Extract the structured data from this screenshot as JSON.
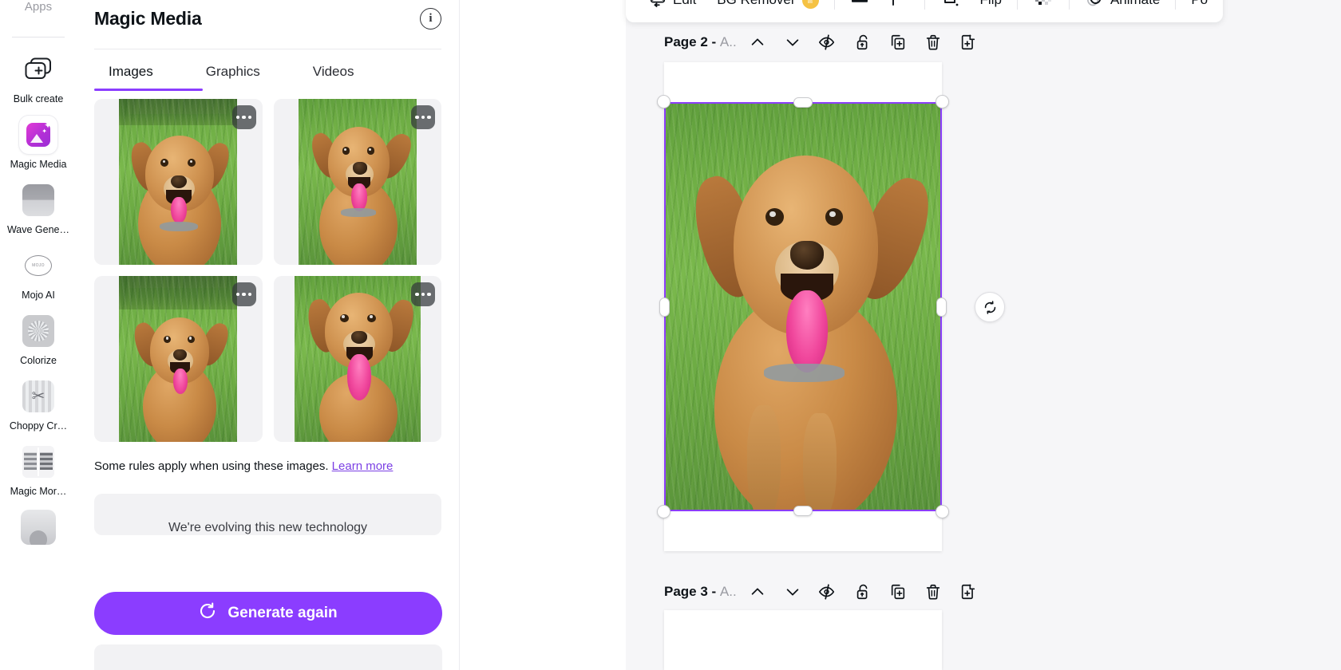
{
  "rail": {
    "title": "Apps",
    "items": [
      {
        "label": "Bulk create",
        "icon": "bulk-create-icon"
      },
      {
        "label": "Magic Media",
        "icon": "magic-media-icon"
      },
      {
        "label": "Wave Gene…",
        "icon": "wave-generator-icon"
      },
      {
        "label": "Mojo AI",
        "icon": "mojo-ai-icon"
      },
      {
        "label": "Colorize",
        "icon": "colorize-icon"
      },
      {
        "label": "Choppy Cr…",
        "icon": "choppy-cropper-icon"
      },
      {
        "label": "Magic Mor…",
        "icon": "magic-morph-icon"
      },
      {
        "label": "",
        "icon": "avatar-icon"
      }
    ]
  },
  "panel": {
    "title": "Magic Media",
    "info_icon": "i",
    "tabs": [
      {
        "label": "Images",
        "active": true
      },
      {
        "label": "Graphics",
        "active": false
      },
      {
        "label": "Videos",
        "active": false
      }
    ],
    "results": [
      {
        "alt": "golden retriever in grass 1",
        "menu": "more-options"
      },
      {
        "alt": "golden retriever in grass 2",
        "menu": "more-options"
      },
      {
        "alt": "golden retriever in grass 3",
        "menu": "more-options"
      },
      {
        "alt": "golden retriever in grass 4",
        "menu": "more-options"
      }
    ],
    "rules_text": "Some rules apply when using these images.",
    "rules_link": "Learn more",
    "evolving_notice": "We're evolving this new technology",
    "generate_button": "Generate again",
    "accent_color": "#8b3dff"
  },
  "toolbar": {
    "items": [
      {
        "label": "Edit",
        "icon": "edit-image-icon",
        "type": "text"
      },
      {
        "label": "BG Remover",
        "icon": "crown-badge-icon",
        "type": "text-premium"
      },
      {
        "label": "",
        "icon": "position-bars-icon",
        "type": "icon"
      },
      {
        "label": "",
        "icon": "corner-radius-icon",
        "type": "icon"
      },
      {
        "label": "",
        "icon": "crop-icon",
        "type": "icon"
      },
      {
        "label": "Flip",
        "icon": "flip-icon",
        "type": "text"
      },
      {
        "label": "",
        "icon": "transparency-icon",
        "type": "icon"
      },
      {
        "label": "Animate",
        "icon": "animate-icon",
        "type": "text"
      },
      {
        "label": "Po",
        "icon": "position-icon",
        "type": "text"
      }
    ]
  },
  "canvas": {
    "pages": [
      {
        "label": "Page 2 - ",
        "label_dim": "A..",
        "controls": [
          {
            "name": "move-up",
            "icon": "chevron-up-icon"
          },
          {
            "name": "move-down",
            "icon": "chevron-down-icon"
          },
          {
            "name": "hide-page",
            "icon": "eye-slash-icon"
          },
          {
            "name": "lock-page",
            "icon": "lock-icon"
          },
          {
            "name": "duplicate-page",
            "icon": "duplicate-icon"
          },
          {
            "name": "delete-page",
            "icon": "trash-icon"
          },
          {
            "name": "add-page",
            "icon": "add-page-icon"
          }
        ]
      },
      {
        "label": "Page 3 - ",
        "label_dim": "A..",
        "controls": [
          {
            "name": "move-up",
            "icon": "chevron-up-icon"
          },
          {
            "name": "move-down",
            "icon": "chevron-down-icon"
          },
          {
            "name": "hide-page",
            "icon": "eye-slash-icon"
          },
          {
            "name": "lock-page",
            "icon": "lock-icon"
          },
          {
            "name": "duplicate-page",
            "icon": "duplicate-icon"
          },
          {
            "name": "delete-page",
            "icon": "trash-icon"
          },
          {
            "name": "add-page",
            "icon": "add-page-icon"
          }
        ]
      }
    ],
    "selection": {
      "color": "#8b3dff",
      "rotate_icon": "rotate-icon"
    }
  }
}
